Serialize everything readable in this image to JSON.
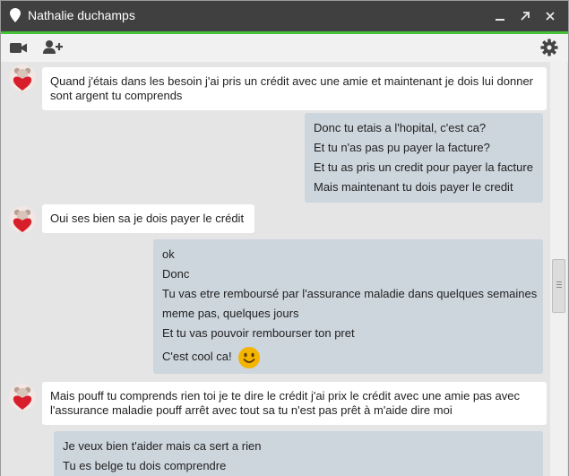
{
  "window": {
    "contact_name": "Nathalie duchamps",
    "controls": {
      "minimize": "minimize-icon",
      "popout": "popout-icon",
      "close": "close-icon"
    }
  },
  "toolbar": {
    "left_icons": [
      "video-call-icon",
      "add-person-icon"
    ],
    "right_icons": [
      "gear-icon"
    ]
  },
  "colors": {
    "titlebar": "#404040",
    "accent": "#47c13a",
    "incoming_bubble": "#ffffff",
    "outgoing_bubble": "#cdd5dd",
    "background": "#e5e5e5"
  },
  "messages": [
    {
      "from": "contact",
      "lines": [
        "Quand j'étais dans les besoin j'ai pris un crédit avec une amie et maintenant je dois lui donner",
        "sont argent tu comprends"
      ]
    },
    {
      "from": "me",
      "lines": [
        "Donc tu etais a l'hopital, c'est ca?",
        "Et tu n'as pas pu payer la facture?",
        "Et tu as pris un credit pour payer la facture",
        "Mais maintenant tu dois payer le credit"
      ]
    },
    {
      "from": "contact",
      "lines": [
        "Oui ses bien sa je dois payer le crédit"
      ]
    },
    {
      "from": "me",
      "lines": [
        "ok",
        "Donc",
        "Tu vas etre remboursé par l'assurance maladie dans quelques semaines",
        "meme pas, quelques jours",
        "Et tu vas pouvoir rembourser ton pret",
        "C'est cool ca!"
      ],
      "emoji": "smiley-emoji-icon"
    },
    {
      "from": "contact",
      "lines": [
        "Mais pouff tu comprends rien toi je te dire le crédit j'ai prix le crédit avec une amie pas avec",
        "l'assurance maladie pouff arrêt avec tout sa tu n'est pas prêt à m'aide dire moi"
      ]
    },
    {
      "from": "me",
      "lines": [
        "Je veux bien t'aider mais ca sert a rien",
        "Tu es belge tu dois comprendre"
      ]
    }
  ]
}
